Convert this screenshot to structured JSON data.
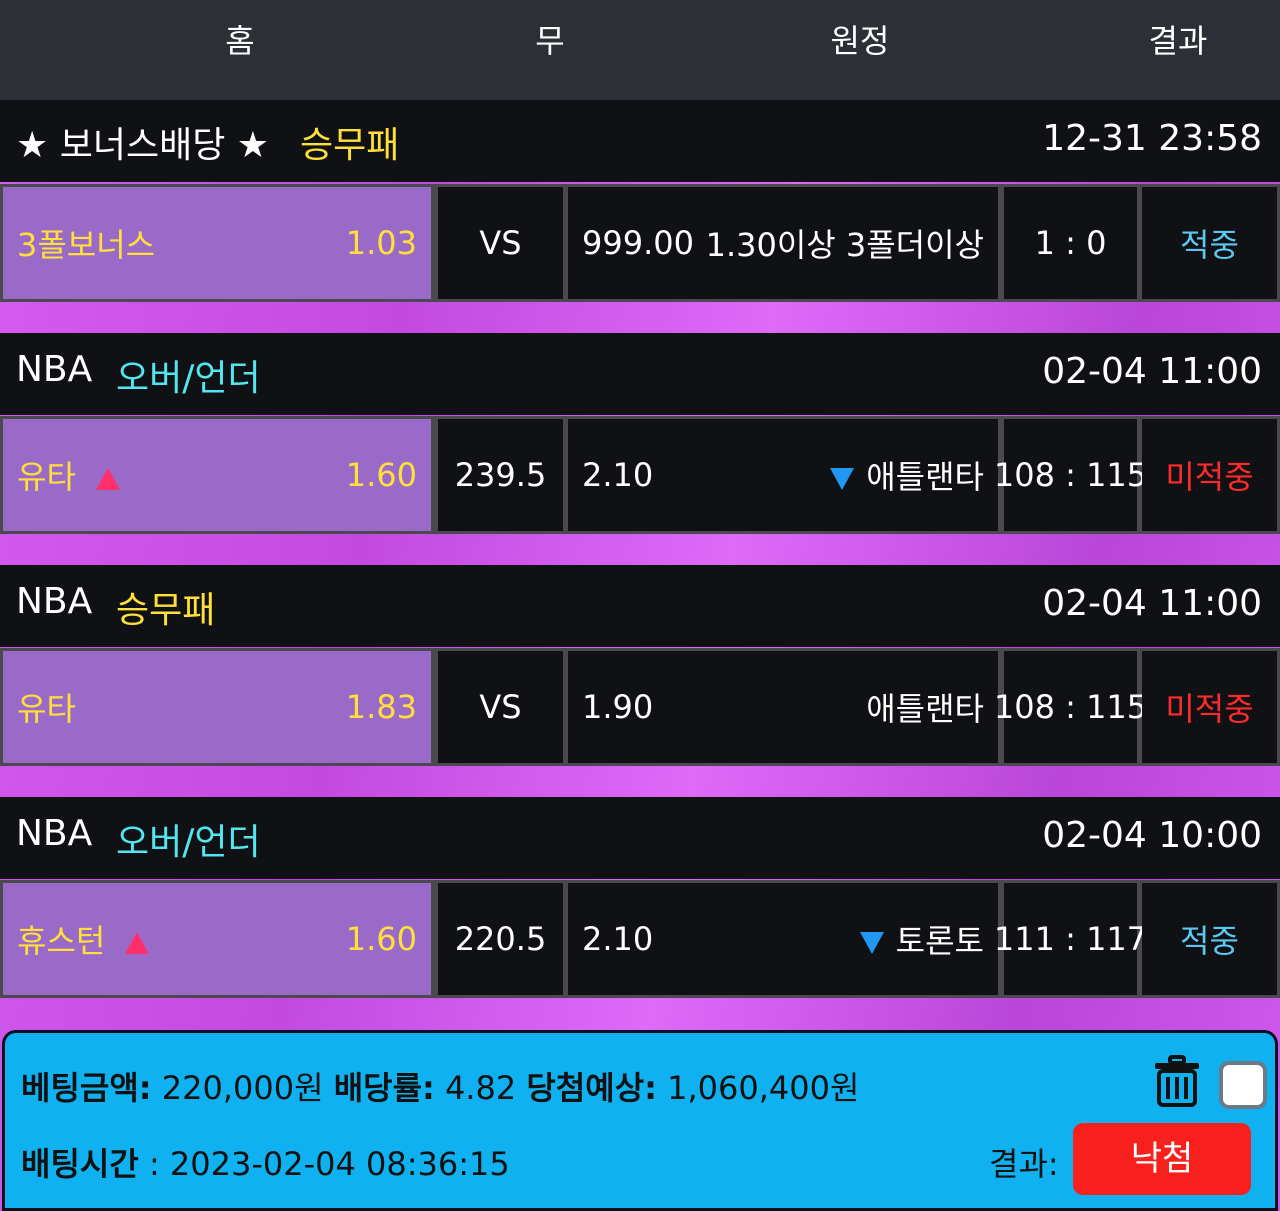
{
  "header": {
    "col_home": "홈",
    "col_draw": "무",
    "col_away": "원정",
    "col_result": "결과"
  },
  "sections": [
    {
      "league": "★ 보너스배당 ★",
      "market": "승무패",
      "market_color": "#ffe03a",
      "time": "12-31 23:58",
      "home_name": "3폴보너스",
      "home_odds": "1.03",
      "mid": "VS",
      "away_odds": "999.00",
      "away_name": "1.30이상 3폴더이상",
      "score": "1 : 0",
      "result": "적중",
      "result_color": "#5cc8f0"
    },
    {
      "league": "NBA",
      "market": "오버/언더",
      "market_color": "#52e6f0",
      "time": "02-04 11:00",
      "home_name": "유타",
      "home_odds": "1.60",
      "mid": "239.5",
      "away_odds": "2.10",
      "away_name": "애틀랜타",
      "score": "108 : 115",
      "result": "미적중",
      "result_color": "#ff2a2a"
    },
    {
      "league": "NBA",
      "market": "승무패",
      "market_color": "#ffe03a",
      "time": "02-04 11:00",
      "home_name": "유타",
      "home_odds": "1.83",
      "mid": "VS",
      "away_odds": "1.90",
      "away_name": "애틀랜타",
      "score": "108 : 115",
      "result": "미적중",
      "result_color": "#ff2a2a"
    },
    {
      "league": "NBA",
      "market": "오버/언더",
      "market_color": "#52e6f0",
      "time": "02-04 10:00",
      "home_name": "휴스턴",
      "home_odds": "1.60",
      "mid": "220.5",
      "away_odds": "2.10",
      "away_name": "토론토",
      "score": "111 : 117",
      "result": "적중",
      "result_color": "#5cc8f0"
    }
  ],
  "footer": {
    "bet_amount_label": "베팅금액:",
    "bet_amount": "220,000원",
    "odds_label": "배당률:",
    "odds": "4.82",
    "expected_label": "당첨예상:",
    "expected": "1,060,400원",
    "bet_time_label": "배팅시간",
    "bet_time": ": 2023-02-04 08:36:15",
    "result_label": "결과:",
    "result_button": "낙첨"
  },
  "icons": {
    "trash": "trash-icon",
    "checkbox": "checkbox-icon",
    "up": "up-arrow-icon",
    "down": "down-arrow-icon"
  }
}
